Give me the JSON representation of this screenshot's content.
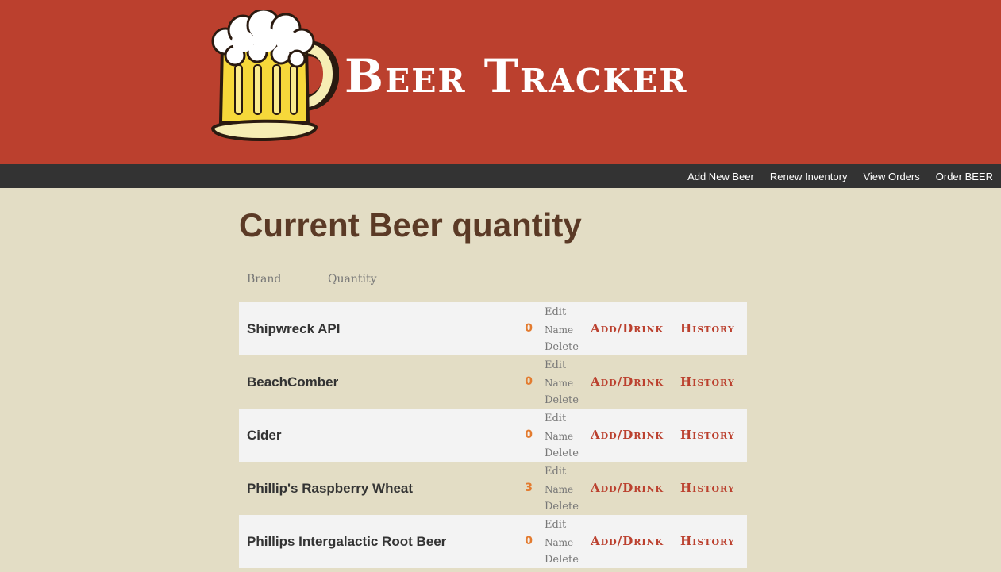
{
  "header": {
    "title": "Beer Tracker",
    "logo_icon": "beer-mug-icon"
  },
  "nav": {
    "items": [
      {
        "label": "Add New Beer"
      },
      {
        "label": "Renew Inventory"
      },
      {
        "label": "View Orders"
      },
      {
        "label": "Order BEER"
      }
    ]
  },
  "main": {
    "title": "Current Beer quantity",
    "columns": {
      "brand": "Brand",
      "quantity": "Quantity"
    },
    "edit_labels": {
      "edit": "Edit",
      "name": "Name",
      "delete": "Delete"
    },
    "actions": {
      "add_drink": "Add/Drink",
      "history": "History"
    },
    "beers": [
      {
        "name": "Shipwreck API",
        "quantity": "0"
      },
      {
        "name": "BeachComber",
        "quantity": "0"
      },
      {
        "name": "Cider",
        "quantity": "0"
      },
      {
        "name": "Phillip's Raspberry Wheat",
        "quantity": "3"
      },
      {
        "name": "Phillips Intergalactic Root Beer",
        "quantity": "0"
      }
    ]
  },
  "colors": {
    "header_bg": "#bb402e",
    "nav_bg": "#333333",
    "page_bg": "#e3ddc5",
    "title": "#5b3a26",
    "quantity": "#e37b2f",
    "action": "#bb402e"
  }
}
